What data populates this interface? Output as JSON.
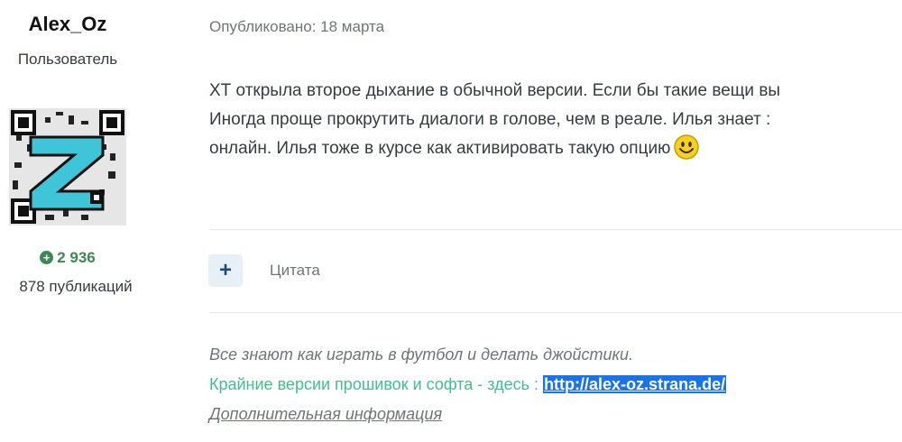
{
  "author": {
    "name": "Alex_Oz",
    "role": "Пользователь",
    "reputation": "2 936",
    "post_count": "878 публикаций"
  },
  "post": {
    "published": "Опубликовано: 18 марта",
    "lines": [
      "ХТ открыла второе дыхание в обычной версии. Если бы такие вещи вы",
      "Иногда  проще прокрутить диалоги в голове, чем в реале. Илья знает :",
      "онлайн. Илья тоже в курсе как активировать такую опцию"
    ]
  },
  "actions": {
    "quote_label": "Цитата"
  },
  "signature": {
    "line1": "Все знают как играть в футбол и делать джойстики.",
    "line2_text": "Крайние версии прошивок и софта - здесь : ",
    "link": "http://alex-oz.strana.de/",
    "more_info": "Дополнительная информация"
  },
  "colors": {
    "reputation": "#3d8754",
    "signature_green": "#3fbf8f",
    "link_bg": "#1a73e8",
    "quote_button_bg": "#e8f0f7",
    "avatar_accent": "#3ec6d8"
  },
  "icons": {
    "reputation": "plus-circle-icon",
    "quote": "plus-icon",
    "emoji": "smiley-icon"
  }
}
